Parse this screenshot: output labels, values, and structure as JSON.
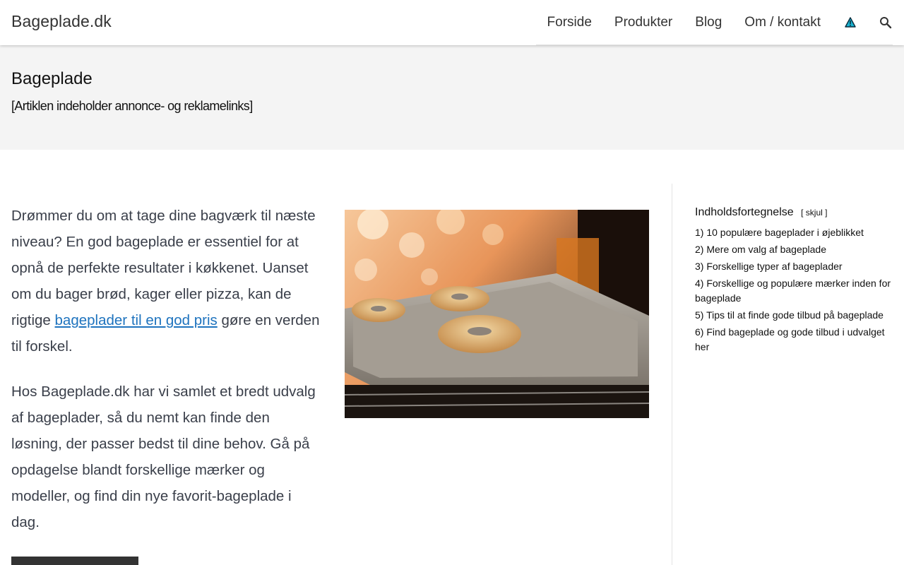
{
  "header": {
    "site_title": "Bageplade.dk",
    "nav": [
      {
        "label": "Forside"
      },
      {
        "label": "Produkter"
      },
      {
        "label": "Blog"
      },
      {
        "label": "Om / kontakt"
      }
    ],
    "icons": {
      "warning": "warning-triangle-icon",
      "search": "search-icon"
    }
  },
  "hero": {
    "title": "Bageplade",
    "notice": "[Artiklen indeholder annonce- og reklamelinks]"
  },
  "content": {
    "p1_before": "Drømmer du om at tage dine bagværk til næste niveau? En god bageplade er essentiel for at opnå de perfekte resultater i køkkenet. Uanset om du bager brød, kager eller pizza, kan de rigtige ",
    "p1_link": "bageplader til en god pris",
    "p1_after": " gøre en verden til forskel.",
    "p2": "Hos Bageplade.dk har vi samlet et bredt udvalg af bageplader, så du nemt kan finde den løsning, der passer bedst til dine behov. Gå på opdagelse blandt forskellige mærker og modeller, og find din nye favorit-bageplade i dag."
  },
  "toc": {
    "title": "Indholdsfortegnelse",
    "toggle_open": "[",
    "toggle_label": "skjul",
    "toggle_close": "]",
    "items": [
      {
        "label": "1) 10 populære bageplader i øjeblikket"
      },
      {
        "label": "2) Mere om valg af bageplade"
      },
      {
        "label": "3) Forskellige typer af bageplader"
      },
      {
        "label": "4) Forskellige og populære mærker inden for bageplade"
      },
      {
        "label": "5) Tips til at finde gode tilbud på bageplade"
      },
      {
        "label": "6) Find bageplade og gode tilbud i udvalget her"
      }
    ]
  },
  "colors": {
    "link": "#1e73be",
    "body_text": "#3a3f4a",
    "band_bg": "#f4f4f4"
  }
}
